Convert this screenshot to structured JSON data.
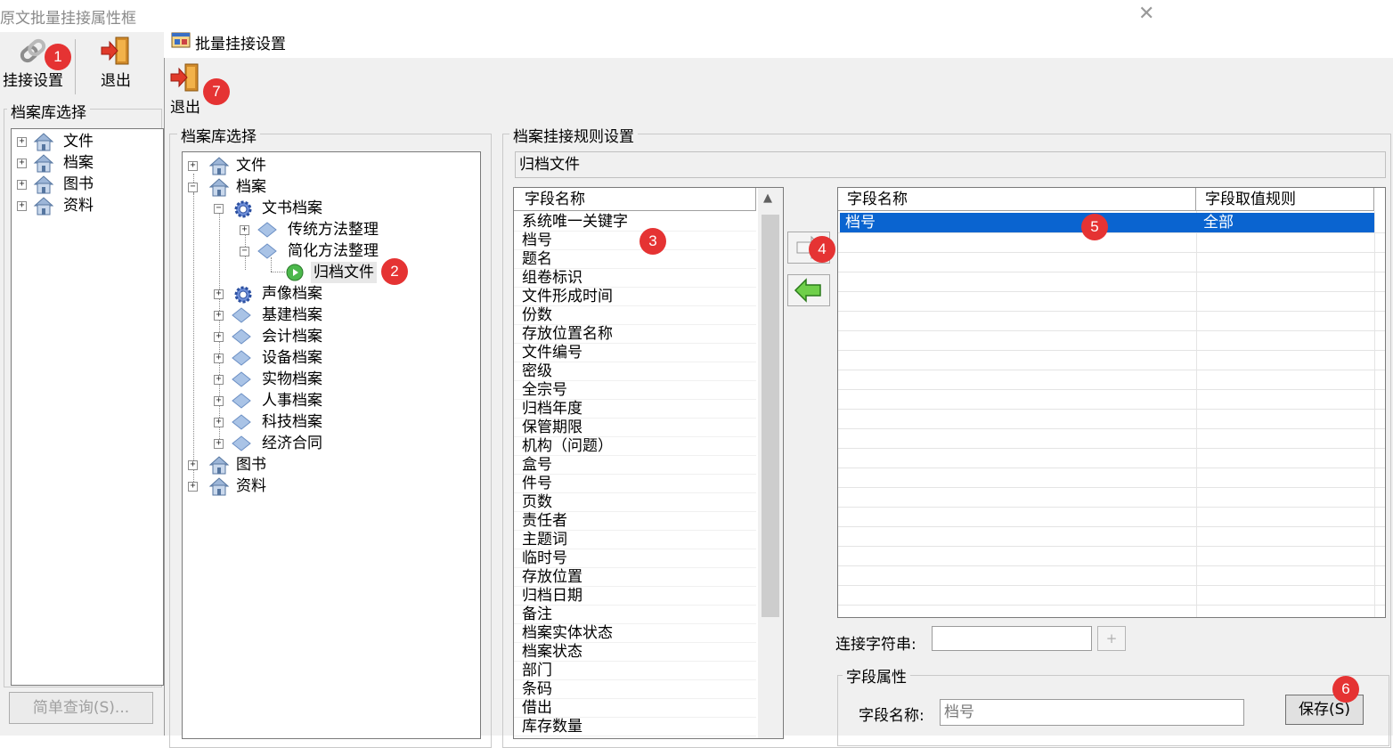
{
  "bg_window": {
    "title": "原文批量挂接属性框",
    "toolbar": {
      "settings_label": "挂接设置",
      "exit_label": "退出"
    },
    "group_label": "档案库选择",
    "tree": [
      "文件",
      "档案",
      "图书",
      "资料"
    ],
    "query_button": "简单查询(S)..."
  },
  "dialog": {
    "title": "批量挂接设置",
    "exit_label": "退出",
    "lib_group_label": "档案库选择",
    "tree": {
      "root1": "文件",
      "root2": "档案",
      "wenshu": "文书档案",
      "chuantong": "传统方法整理",
      "jianhua": "简化方法整理",
      "guidang": "归档文件",
      "children": [
        "声像档案",
        "基建档案",
        "会计档案",
        "设备档案",
        "实物档案",
        "人事档案",
        "科技档案",
        "经济合同"
      ],
      "root3": "图书",
      "root4": "资料"
    },
    "rule_group_label": "档案挂接规则设置",
    "rule_path": "归档文件",
    "field_list": {
      "header": "字段名称",
      "items": [
        "系统唯一关键字",
        "档号",
        "题名",
        "组卷标识",
        "文件形成时间",
        "份数",
        "存放位置名称",
        "文件编号",
        "密级",
        "全宗号",
        "归档年度",
        "保管期限",
        "机构（问题）",
        "盒号",
        "件号",
        "页数",
        "责任者",
        "主题词",
        "临时号",
        "存放位置",
        "归档日期",
        "备注",
        "档案实体状态",
        "档案状态",
        "部门",
        "条码",
        "借出",
        "库存数量"
      ]
    },
    "selected_grid": {
      "col1": "字段名称",
      "col2": "字段取值规则",
      "row_name": "档号",
      "row_rule": "全部"
    },
    "join_label": "连接字符串:",
    "join_button": "+",
    "attr_group_label": "字段属性",
    "field_name_label": "字段名称:",
    "field_name_value": "档号",
    "save_button": "保存(S)"
  },
  "badges": [
    "1",
    "2",
    "3",
    "4",
    "5",
    "6",
    "7"
  ],
  "colors": {
    "selection": "#0a64d0",
    "badge": "#e53333"
  }
}
